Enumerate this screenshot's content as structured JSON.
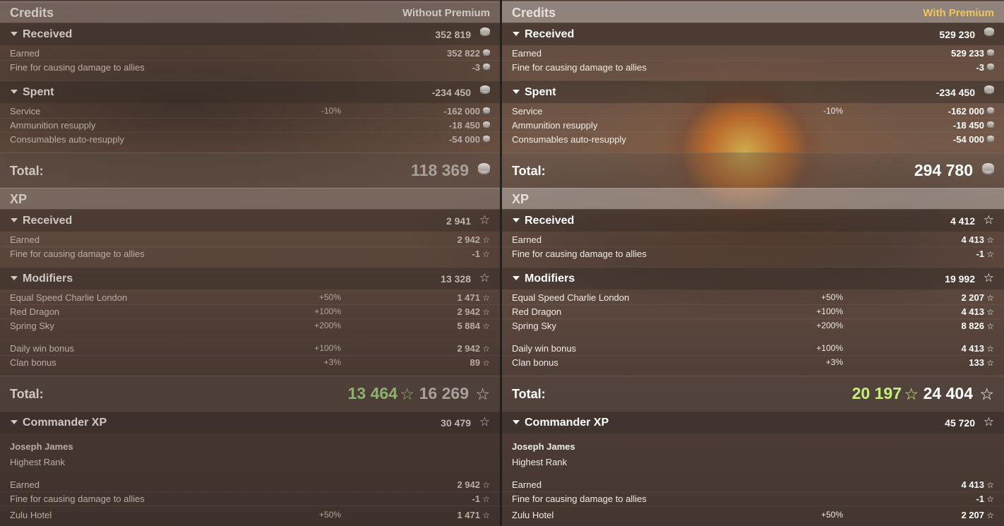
{
  "panels": {
    "left": {
      "credits_title": "Credits",
      "mode": "Without Premium",
      "received": {
        "label": "Received",
        "value": "352 819",
        "earned_label": "Earned",
        "earned_value": "352 822",
        "fine_label": "Fine for causing damage to allies",
        "fine_value": "-3"
      },
      "spent": {
        "label": "Spent",
        "value": "-234 450",
        "service_label": "Service",
        "service_pct": "-10%",
        "service_value": "-162 000",
        "ammo_label": "Ammunition resupply",
        "ammo_value": "-18 450",
        "cons_label": "Consumables auto-resupply",
        "cons_value": "-54 000"
      },
      "credits_total_label": "Total:",
      "credits_total": "118 369",
      "xp_title": "XP",
      "xp_received": {
        "label": "Received",
        "value": "2 941",
        "earned_label": "Earned",
        "earned_value": "2 942",
        "fine_label": "Fine for causing damage to allies",
        "fine_value": "-1"
      },
      "modifiers": {
        "label": "Modifiers",
        "value": "13 328",
        "m1_label": "Equal Speed Charlie London",
        "m1_pct": "+50%",
        "m1_value": "1 471",
        "m2_label": "Red Dragon",
        "m2_pct": "+100%",
        "m2_value": "2 942",
        "m3_label": "Spring Sky",
        "m3_pct": "+200%",
        "m3_value": "5 884",
        "m4_label": "Daily win bonus",
        "m4_pct": "+100%",
        "m4_value": "2 942",
        "m5_label": "Clan bonus",
        "m5_pct": "+3%",
        "m5_value": "89"
      },
      "xp_total_label": "Total:",
      "xp_total_free": "13 464",
      "xp_total": "16 269",
      "commander": {
        "label": "Commander XP",
        "value": "30 479",
        "name": "Joseph James",
        "rank": "Highest Rank",
        "earned_label": "Earned",
        "earned_value": "2 942",
        "fine_label": "Fine for causing damage to allies",
        "fine_value": "-1",
        "zulu_label": "Zulu Hotel",
        "zulu_pct": "+50%",
        "zulu_value": "1 471"
      }
    },
    "right": {
      "credits_title": "Credits",
      "mode": "With Premium",
      "received": {
        "label": "Received",
        "value": "529 230",
        "earned_label": "Earned",
        "earned_value": "529 233",
        "fine_label": "Fine for causing damage to allies",
        "fine_value": "-3"
      },
      "spent": {
        "label": "Spent",
        "value": "-234 450",
        "service_label": "Service",
        "service_pct": "-10%",
        "service_value": "-162 000",
        "ammo_label": "Ammunition resupply",
        "ammo_value": "-18 450",
        "cons_label": "Consumables auto-resupply",
        "cons_value": "-54 000"
      },
      "credits_total_label": "Total:",
      "credits_total": "294 780",
      "xp_title": "XP",
      "xp_received": {
        "label": "Received",
        "value": "4 412",
        "earned_label": "Earned",
        "earned_value": "4 413",
        "fine_label": "Fine for causing damage to allies",
        "fine_value": "-1"
      },
      "modifiers": {
        "label": "Modifiers",
        "value": "19 992",
        "m1_label": "Equal Speed Charlie London",
        "m1_pct": "+50%",
        "m1_value": "2 207",
        "m2_label": "Red Dragon",
        "m2_pct": "+100%",
        "m2_value": "4 413",
        "m3_label": "Spring Sky",
        "m3_pct": "+200%",
        "m3_value": "8 826",
        "m4_label": "Daily win bonus",
        "m4_pct": "+100%",
        "m4_value": "4 413",
        "m5_label": "Clan bonus",
        "m5_pct": "+3%",
        "m5_value": "133"
      },
      "xp_total_label": "Total:",
      "xp_total_free": "20 197",
      "xp_total": "24 404",
      "commander": {
        "label": "Commander XP",
        "value": "45 720",
        "name": "Joseph James",
        "rank": "Highest Rank",
        "earned_label": "Earned",
        "earned_value": "4 413",
        "fine_label": "Fine for causing damage to allies",
        "fine_value": "-1",
        "zulu_label": "Zulu Hotel",
        "zulu_pct": "+50%",
        "zulu_value": "2 207"
      }
    }
  },
  "colors": {
    "premium_accent": "#f0c65a",
    "free_xp_left": "#8fb070",
    "free_xp_right": "#c6f07d"
  },
  "icons": {
    "credits": "coin-icon",
    "xp": "star-icon",
    "collapse": "triangle-down-icon"
  }
}
